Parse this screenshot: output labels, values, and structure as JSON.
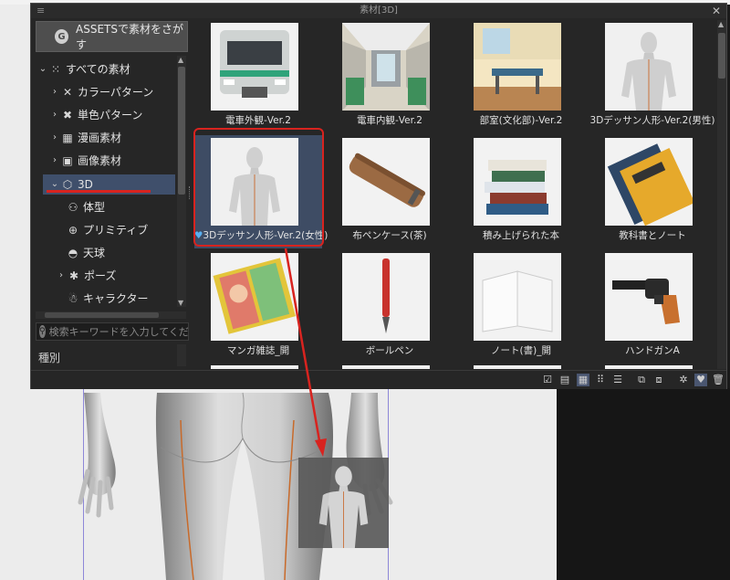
{
  "dialog": {
    "title": "素材[3D]"
  },
  "assets_button": {
    "label": "ASSETSで素材をさがす"
  },
  "tree": {
    "items": [
      {
        "label": "すべての素材",
        "icon": "grid-dots-icon"
      },
      {
        "label": "カラーパターン",
        "icon": "crossed-pattern-icon"
      },
      {
        "label": "単色パターン",
        "icon": "crossed-pattern-icon"
      },
      {
        "label": "漫画素材",
        "icon": "manga-frame-icon"
      },
      {
        "label": "画像素材",
        "icon": "image-icon"
      },
      {
        "label": "3D",
        "icon": "cube-icon"
      },
      {
        "label": "体型",
        "icon": "body-type-icon"
      },
      {
        "label": "プリミティブ",
        "icon": "sphere-icon"
      },
      {
        "label": "天球",
        "icon": "dome-icon"
      },
      {
        "label": "ポーズ",
        "icon": "pose-icon"
      },
      {
        "label": "キャラクター",
        "icon": "character-icon"
      }
    ]
  },
  "search": {
    "placeholder": "検索キーワードを入力してくだ..."
  },
  "type_label": "種別",
  "materials": [
    {
      "label": "電車外観-Ver.2",
      "thumb": "train-exterior",
      "favorite": false
    },
    {
      "label": "電車内観-Ver.2",
      "thumb": "train-interior",
      "favorite": false
    },
    {
      "label": "部室(文化部)-Ver.2",
      "thumb": "clubroom",
      "favorite": false
    },
    {
      "label": "3Dデッサン人形-Ver.2(男性)",
      "thumb": "mannequin-male",
      "favorite": false
    },
    {
      "label": "3Dデッサン人形-Ver.2(女性)",
      "thumb": "mannequin-female",
      "favorite": true
    },
    {
      "label": "布ペンケース(茶)",
      "thumb": "pencil-case",
      "favorite": false
    },
    {
      "label": "積み上げられた本",
      "thumb": "stacked-books",
      "favorite": false
    },
    {
      "label": "教科書とノート",
      "thumb": "textbook",
      "favorite": false
    },
    {
      "label": "マンガ雑誌_開",
      "thumb": "manga-magazine",
      "favorite": false
    },
    {
      "label": "ボールペン",
      "thumb": "ballpoint-pen",
      "favorite": false
    },
    {
      "label": "ノート(書)_開",
      "thumb": "open-notebook",
      "favorite": false
    },
    {
      "label": "ハンドガンA",
      "thumb": "handgun",
      "favorite": false
    }
  ],
  "colors": {
    "selection": "#3e4c64",
    "annotation": "#d8231f",
    "favorite": "#5ab0f0"
  }
}
